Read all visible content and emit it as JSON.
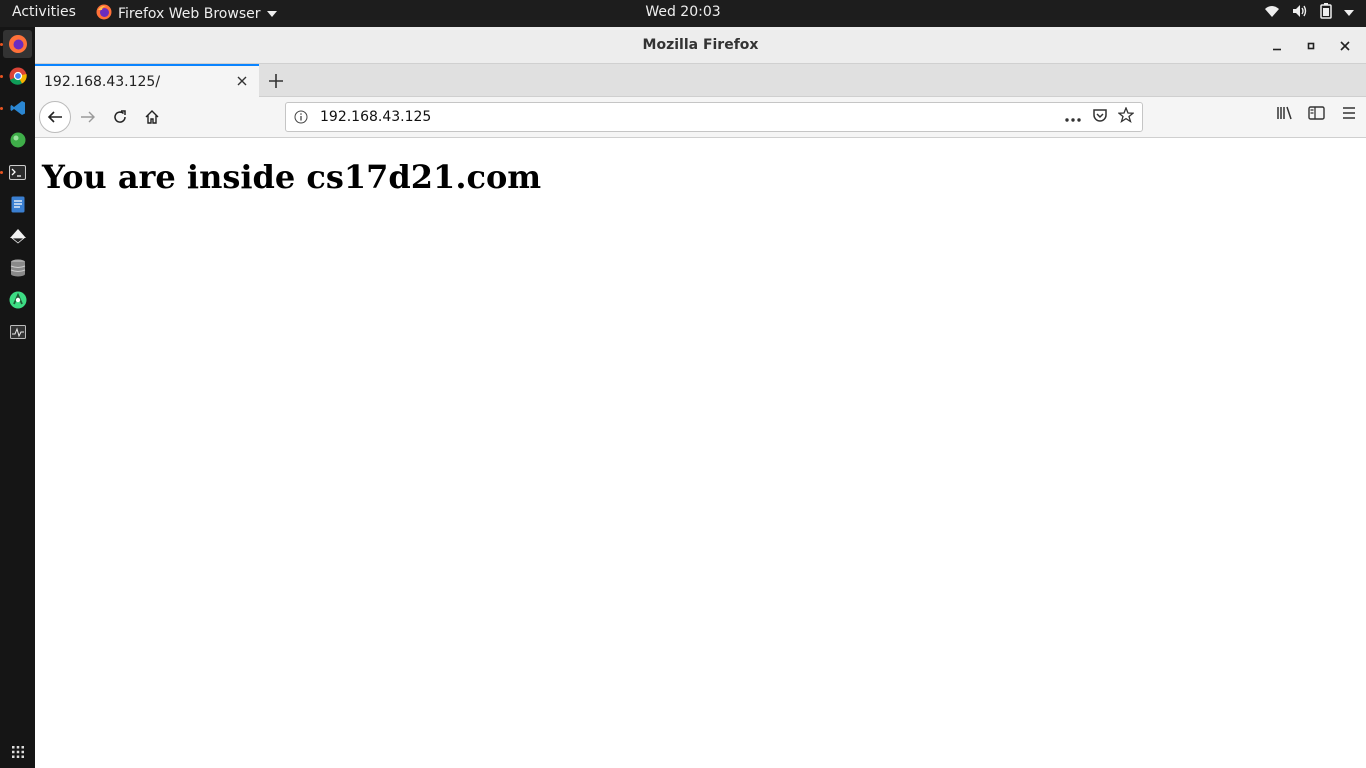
{
  "topbar": {
    "activities": "Activities",
    "app_name": "Firefox Web Browser",
    "clock": "Wed 20:03"
  },
  "window": {
    "title": "Mozilla Firefox"
  },
  "tabs": [
    {
      "label": "192.168.43.125/"
    }
  ],
  "urlbar": {
    "url": "192.168.43.125"
  },
  "page": {
    "heading": "You are inside cs17d21.com"
  },
  "colors": {
    "accent": "#0a84ff",
    "dock_indicator": "#e95420"
  },
  "dock": {
    "items": [
      "firefox-icon",
      "chrome-icon",
      "vscode-icon",
      "app-green-icon",
      "terminal-icon",
      "text-editor-icon",
      "inkscape-icon",
      "database-icon",
      "android-studio-icon",
      "system-monitor-icon"
    ],
    "apps_grid": "show-applications-icon"
  }
}
